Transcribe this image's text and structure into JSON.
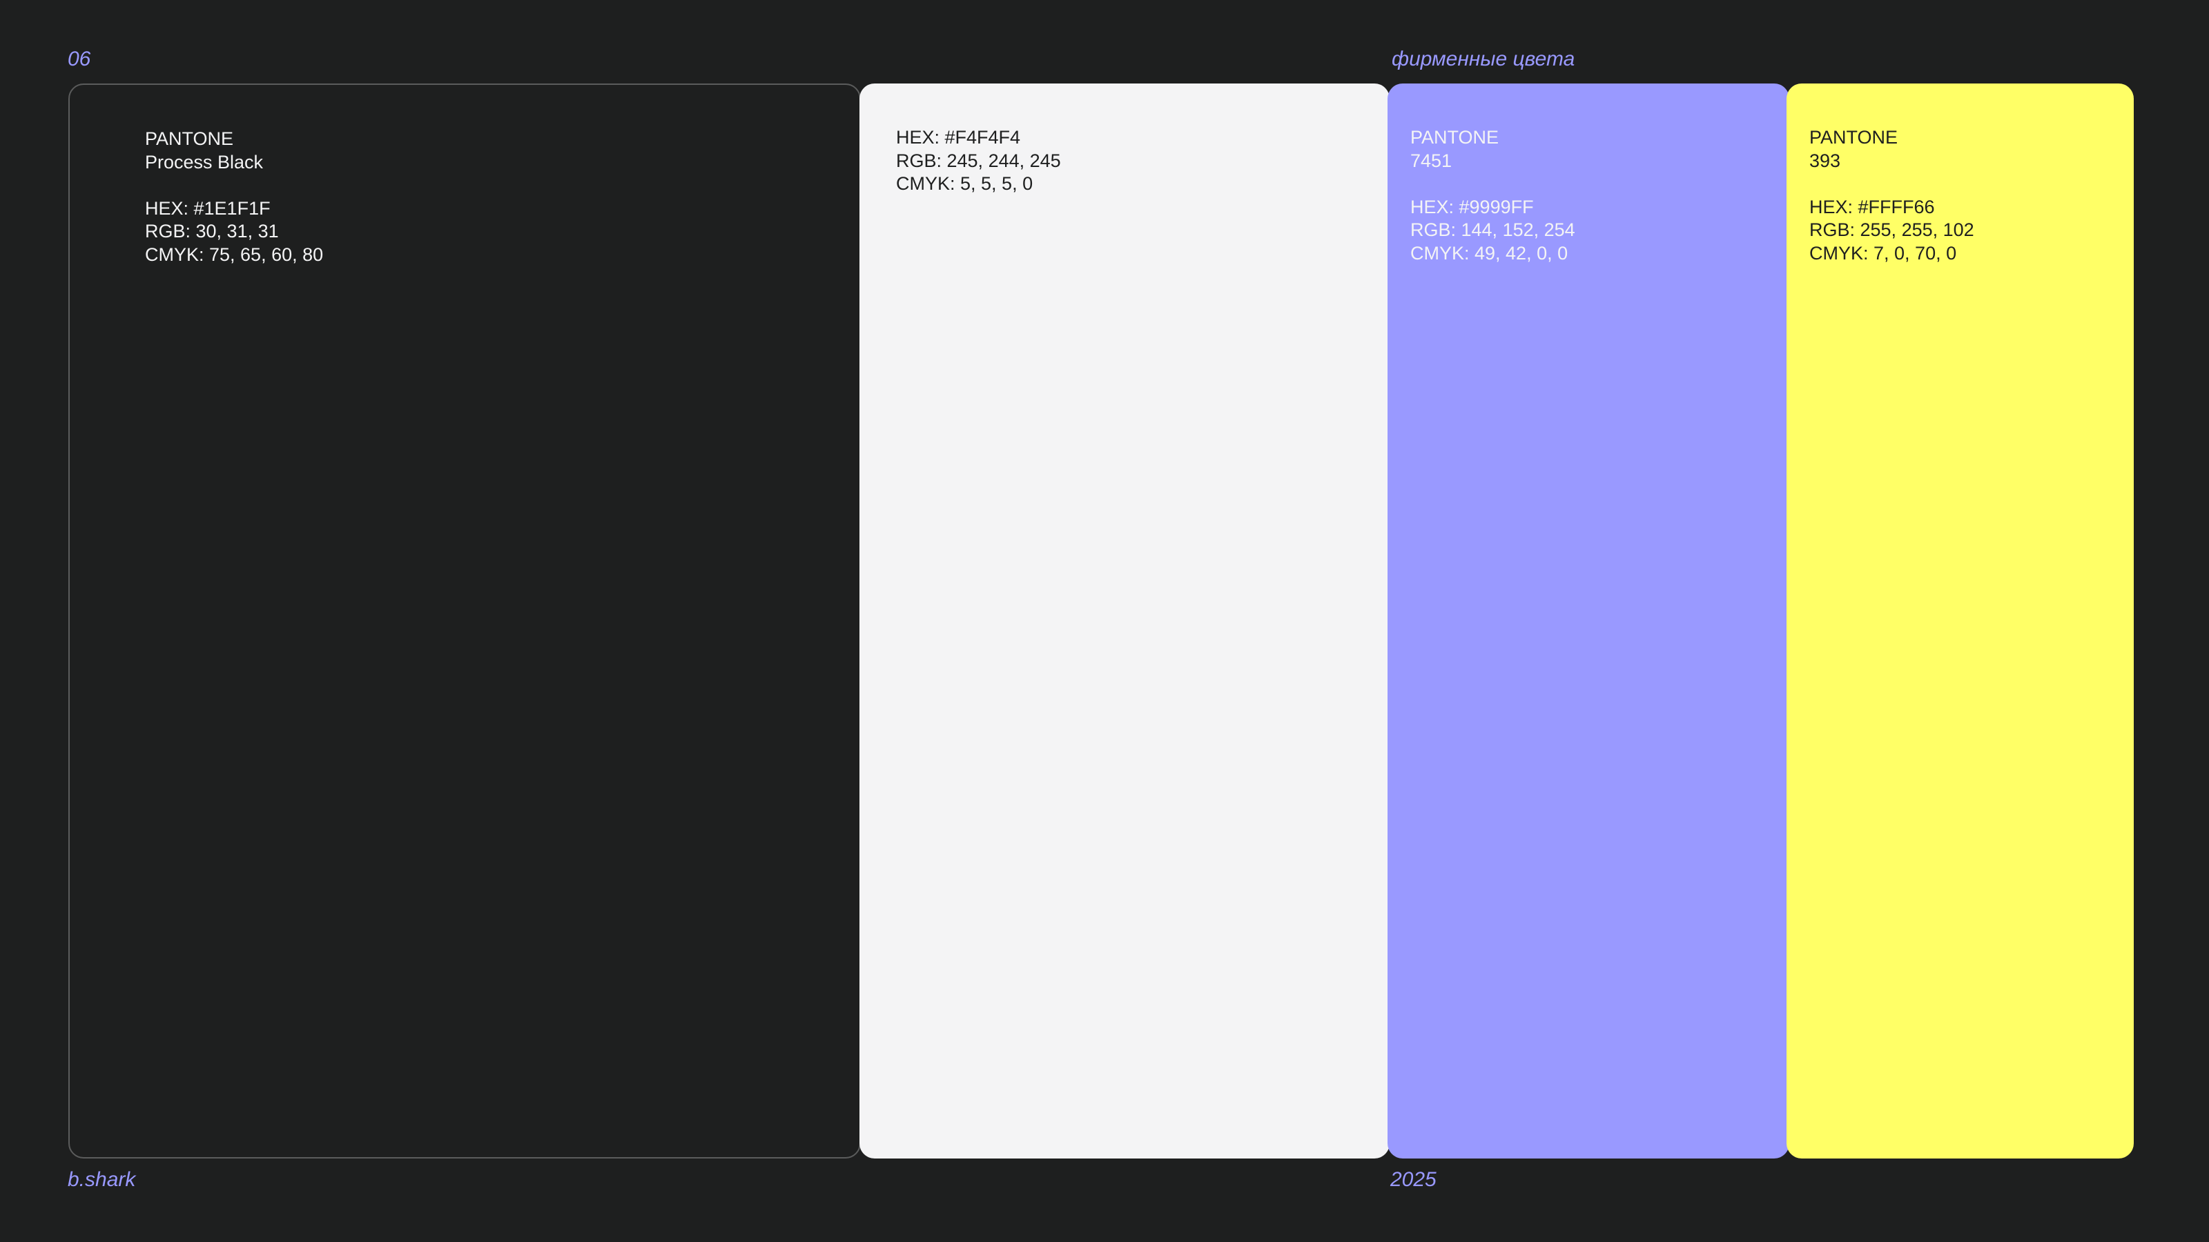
{
  "header": {
    "page_number": "06",
    "section_title": "фирменные цвета"
  },
  "footer": {
    "brand": "b.shark",
    "year": "2025"
  },
  "colors": [
    {
      "pantone_label": "PANTONE",
      "pantone_name": "Process Black",
      "hex": "HEX: #1E1F1F",
      "rgb": "RGB: 30, 31, 31",
      "cmyk": "CMYK: 75, 65, 60, 80",
      "swatch": "#1E1F1F"
    },
    {
      "hex": "HEX: #F4F4F4",
      "rgb": "RGB: 245, 244, 245",
      "cmyk": "CMYK: 5, 5, 5, 0",
      "swatch": "#F4F4F5"
    },
    {
      "pantone_label": "PANTONE",
      "pantone_name": "7451",
      "hex": "HEX: #9999FF",
      "rgb": "RGB: 144, 152, 254",
      "cmyk": "CMYK: 49, 42, 0, 0",
      "swatch": "#9999FF"
    },
    {
      "pantone_label": "PANTONE",
      "pantone_name": "393",
      "hex": "HEX: #FFFF66",
      "rgb": "RGB: 255, 255, 102",
      "cmyk": "CMYK: 7, 0, 70, 0",
      "swatch": "#FFFF66"
    }
  ],
  "accent_color": "#9999FF"
}
